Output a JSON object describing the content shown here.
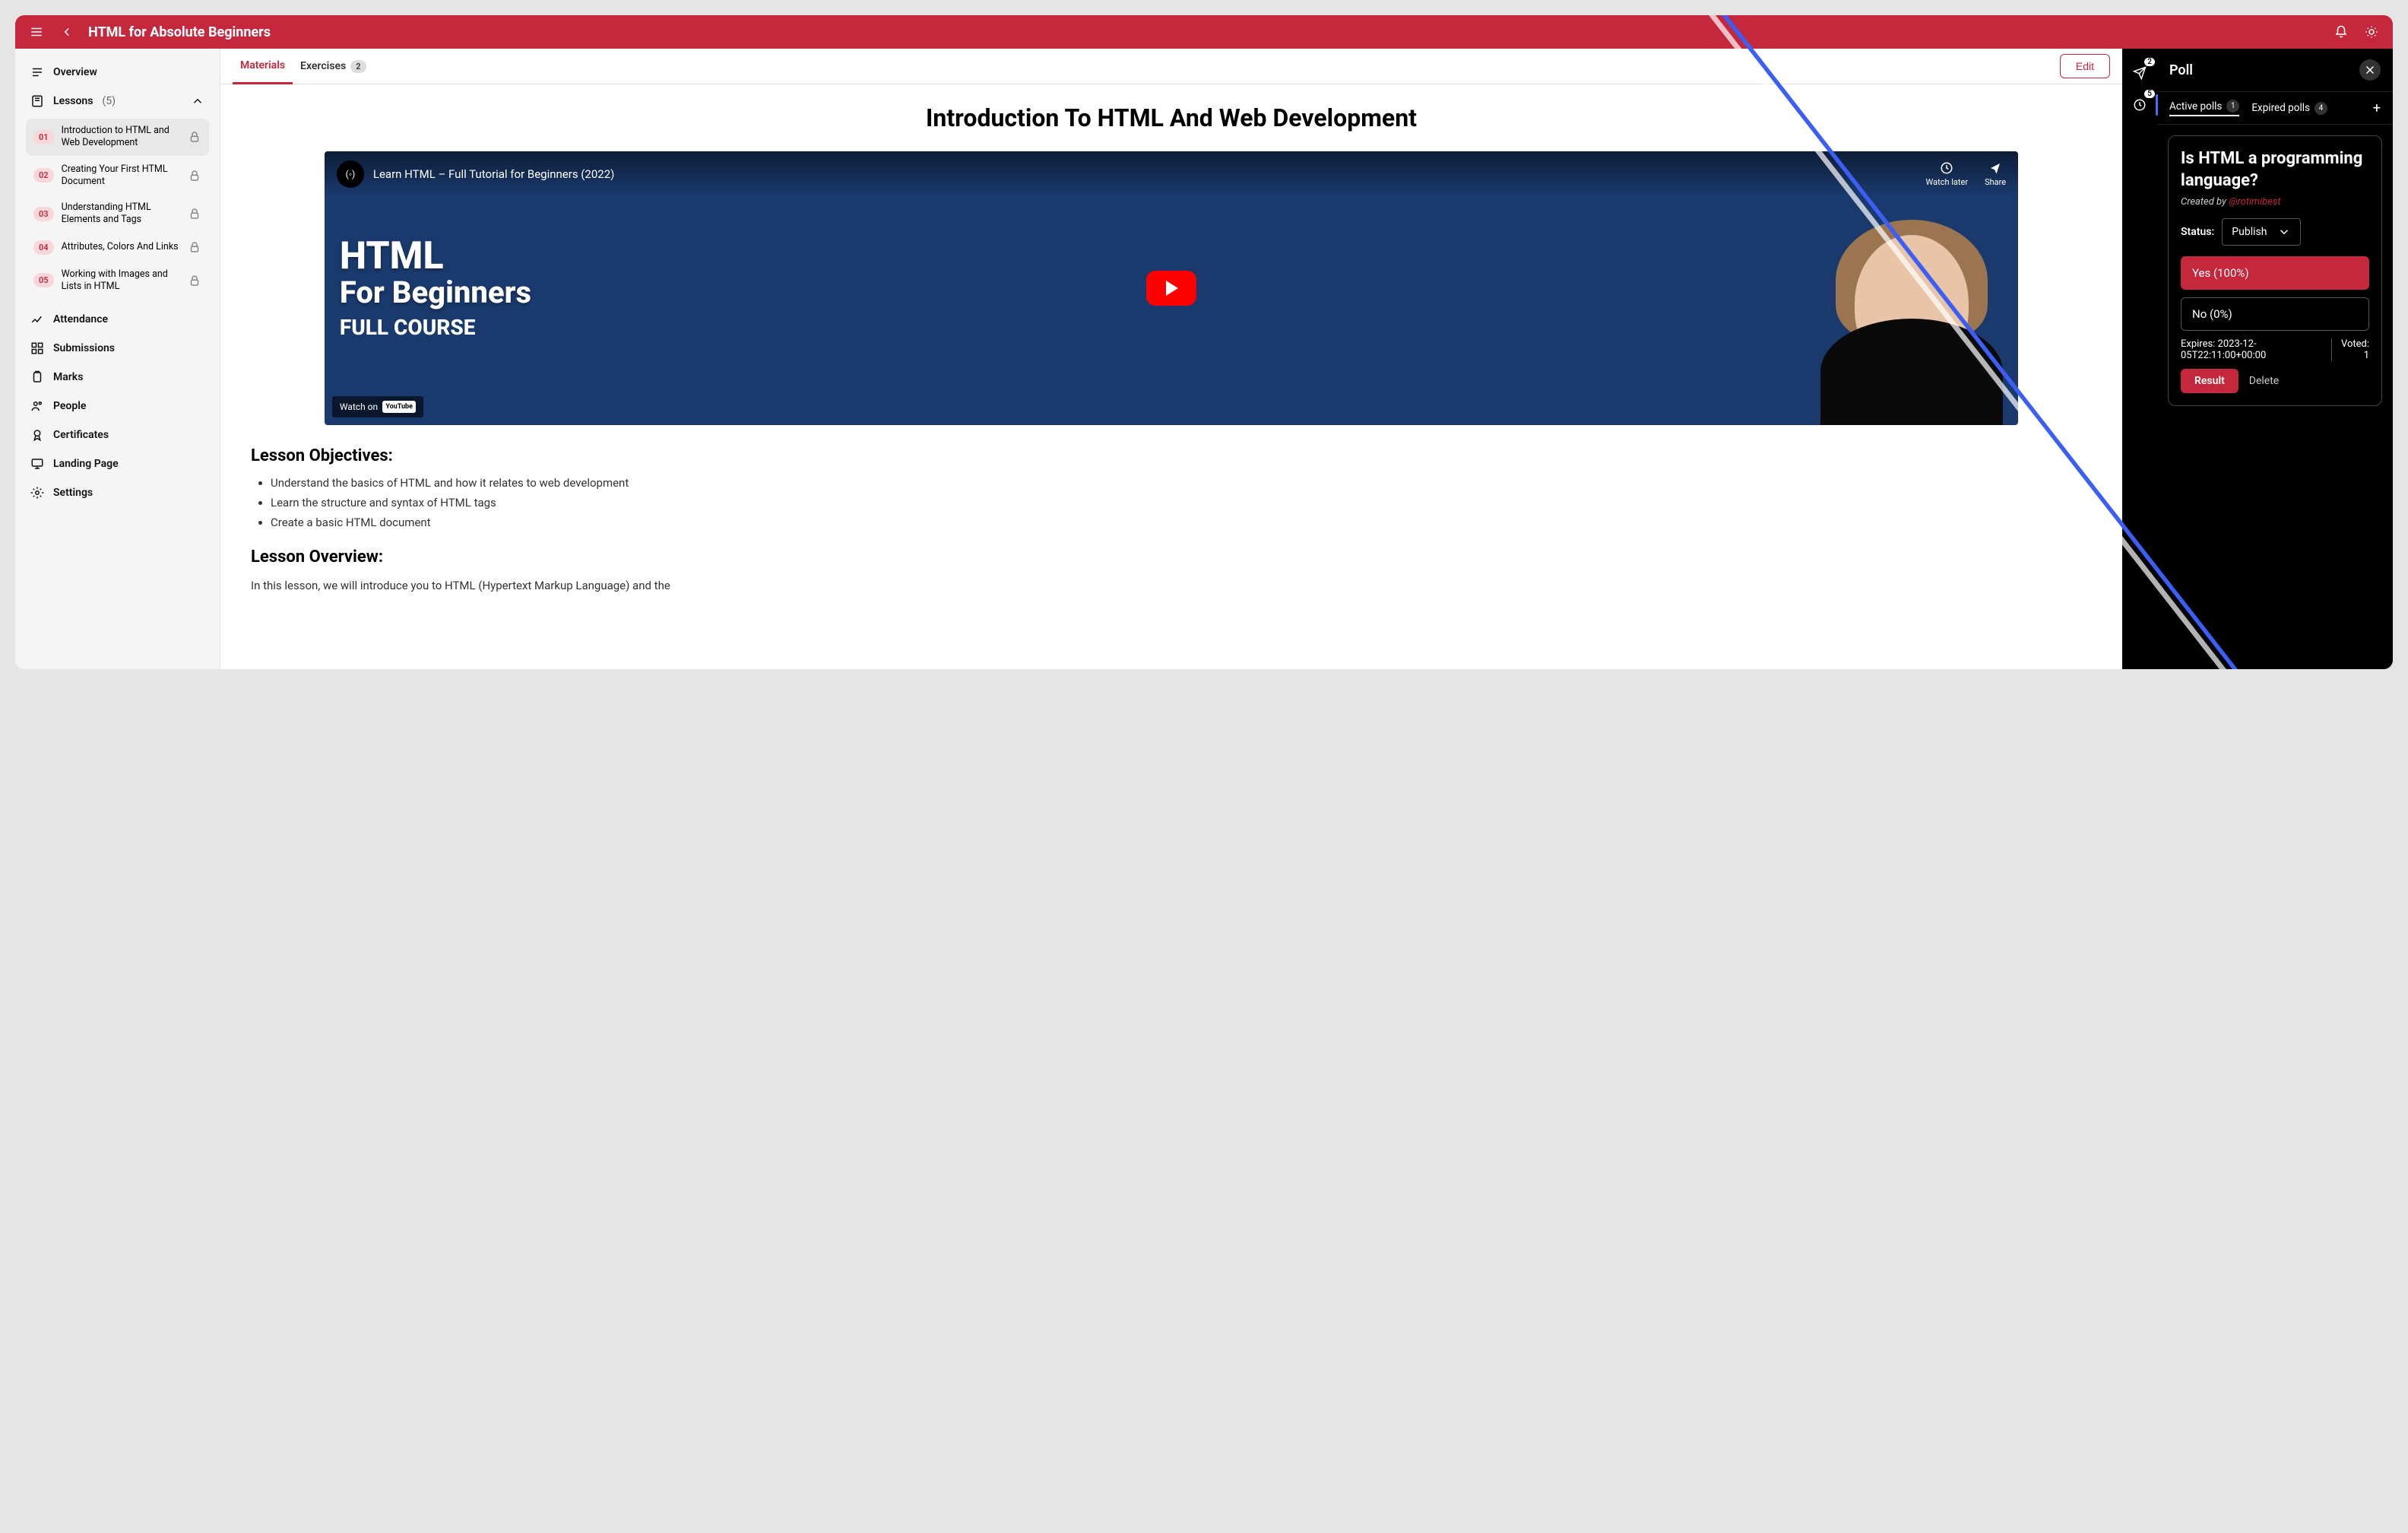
{
  "header": {
    "title": "HTML for Absolute Beginners"
  },
  "sidebar": {
    "overview": "Overview",
    "lessons_label": "Lessons",
    "lessons_count": "(5)",
    "lessons": [
      {
        "num": "01",
        "title": "Introduction to HTML and Web Development"
      },
      {
        "num": "02",
        "title": "Creating Your First HTML Document"
      },
      {
        "num": "03",
        "title": "Understanding HTML Elements and Tags"
      },
      {
        "num": "04",
        "title": "Attributes, Colors And Links"
      },
      {
        "num": "05",
        "title": "Working with Images and Lists in HTML"
      }
    ],
    "attendance": "Attendance",
    "submissions": "Submissions",
    "marks": "Marks",
    "people": "People",
    "certificates": "Certificates",
    "landing_page": "Landing Page",
    "settings": "Settings"
  },
  "tabs": {
    "materials": "Materials",
    "exercises": "Exercises",
    "exercises_count": "2",
    "edit": "Edit"
  },
  "content": {
    "heading": "Introduction To HTML And Web Development",
    "video": {
      "title": "Learn HTML – Full Tutorial for Beginners (2022)",
      "watch_later": "Watch later",
      "share": "Share",
      "watch_on": "Watch on",
      "youtube": "YouTube",
      "big_line1": "HTML",
      "big_line2": "For Beginners",
      "sub_line": "FULL COURSE"
    },
    "objectives_title": "Lesson Objectives:",
    "objectives": [
      "Understand the basics of HTML and how it relates to web development",
      "Learn the structure and syntax of HTML tags",
      "Create a basic HTML document"
    ],
    "overview_title": "Lesson Overview:",
    "overview_text": "In this lesson, we will introduce you to HTML (Hypertext Markup Language) and the"
  },
  "rail": {
    "send_badge": "2",
    "history_badge": "5"
  },
  "poll": {
    "title": "Poll",
    "active_label": "Active polls",
    "active_count": "1",
    "expired_label": "Expired polls",
    "expired_count": "4",
    "question": "Is HTML a programming language?",
    "created_prefix": "Created by ",
    "author": "@rotimibest",
    "status_label": "Status:",
    "status_value": "Publish",
    "option_yes": "Yes (100%)",
    "option_no": "No (0%)",
    "expires": "Expires: 2023-12-05T22:11:00+00:00",
    "voted_label": "Voted:",
    "voted_count": "1",
    "result": "Result",
    "delete": "Delete"
  }
}
